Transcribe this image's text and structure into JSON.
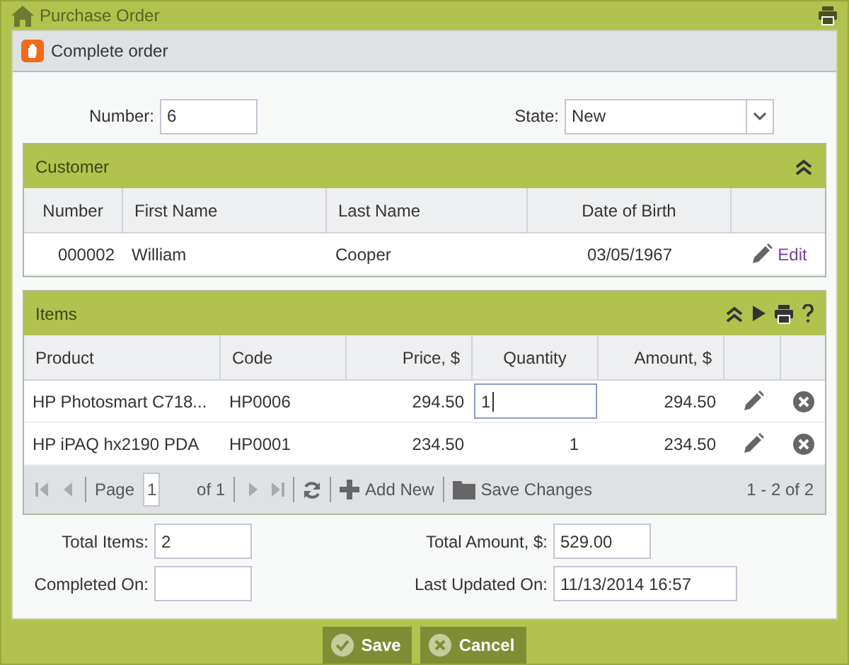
{
  "window": {
    "title": "Purchase Order"
  },
  "toolbar": {
    "action": "Complete order"
  },
  "form": {
    "number": {
      "label": "Number:",
      "value": "6"
    },
    "state": {
      "label": "State:",
      "value": "New"
    }
  },
  "customer": {
    "title": "Customer",
    "columns": [
      "Number",
      "First Name",
      "Last Name",
      "Date of Birth"
    ],
    "rows": [
      {
        "cells": [
          "000002",
          "William",
          "Cooper",
          "03/05/1967"
        ],
        "action": "Edit"
      }
    ]
  },
  "items": {
    "title": "Items",
    "columns": [
      "Product",
      "Code",
      "Price, $",
      "Quantity",
      "Amount, $"
    ],
    "rows": [
      {
        "product": "HP Photosmart C718...",
        "code": "HP0006",
        "price": "294.50",
        "quantity": "1",
        "amount": "294.50",
        "editing": true
      },
      {
        "product": "HP iPAQ hx2190 PDA",
        "code": "HP0001",
        "price": "234.50",
        "quantity": "1",
        "amount": "234.50",
        "editing": false
      }
    ],
    "pager": {
      "page_label": "Page",
      "page": "1",
      "of": "of 1",
      "add": "Add New",
      "save": "Save Changes",
      "summary": "1 - 2 of 2"
    }
  },
  "totals": [
    {
      "label": "Total Items:",
      "value": "2"
    },
    {
      "label": "Total Amount, $:",
      "value": "529.00"
    },
    {
      "label": "Completed On:"
    },
    {
      "label": "Last Updated On:",
      "value": "11/13/2014 16:57"
    }
  ],
  "buttons": [
    {
      "label": "Save",
      "kind": "save"
    },
    {
      "label": "Cancel",
      "kind": "cancel"
    }
  ]
}
